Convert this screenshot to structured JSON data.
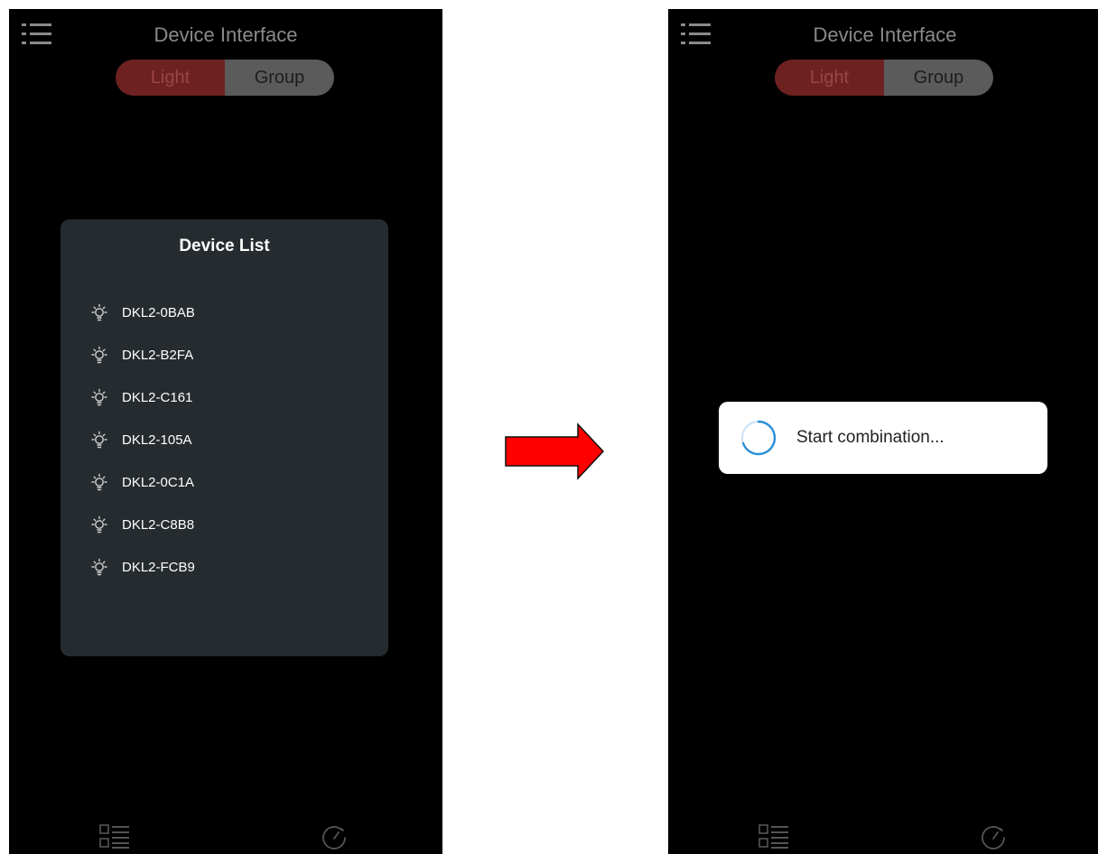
{
  "header": {
    "title": "Device Interface"
  },
  "segment": {
    "light_label": "Light",
    "group_label": "Group"
  },
  "device_list": {
    "title": "Device List",
    "items": [
      {
        "label": "DKL2-0BAB"
      },
      {
        "label": "DKL2-B2FA"
      },
      {
        "label": "DKL2-C161"
      },
      {
        "label": "DKL2-105A"
      },
      {
        "label": "DKL2-0C1A"
      },
      {
        "label": "DKL2-C8B8"
      },
      {
        "label": "DKL2-FCB9"
      }
    ]
  },
  "dialog": {
    "message": "Start combination..."
  },
  "icons": {
    "menu": "menu-list-icon",
    "bulb": "light-bulb-icon",
    "nav_list": "device-list-icon",
    "nav_gauge": "gauge-icon",
    "spinner": "loading-spinner-icon",
    "arrow": "right-arrow-icon"
  },
  "colors": {
    "background": "#000000",
    "panel": "#252b2e",
    "segment_active": "#6e2121",
    "segment_inactive": "#5b5b5b",
    "arrow": "#ff0000",
    "spinner": "#2a8fd8"
  }
}
